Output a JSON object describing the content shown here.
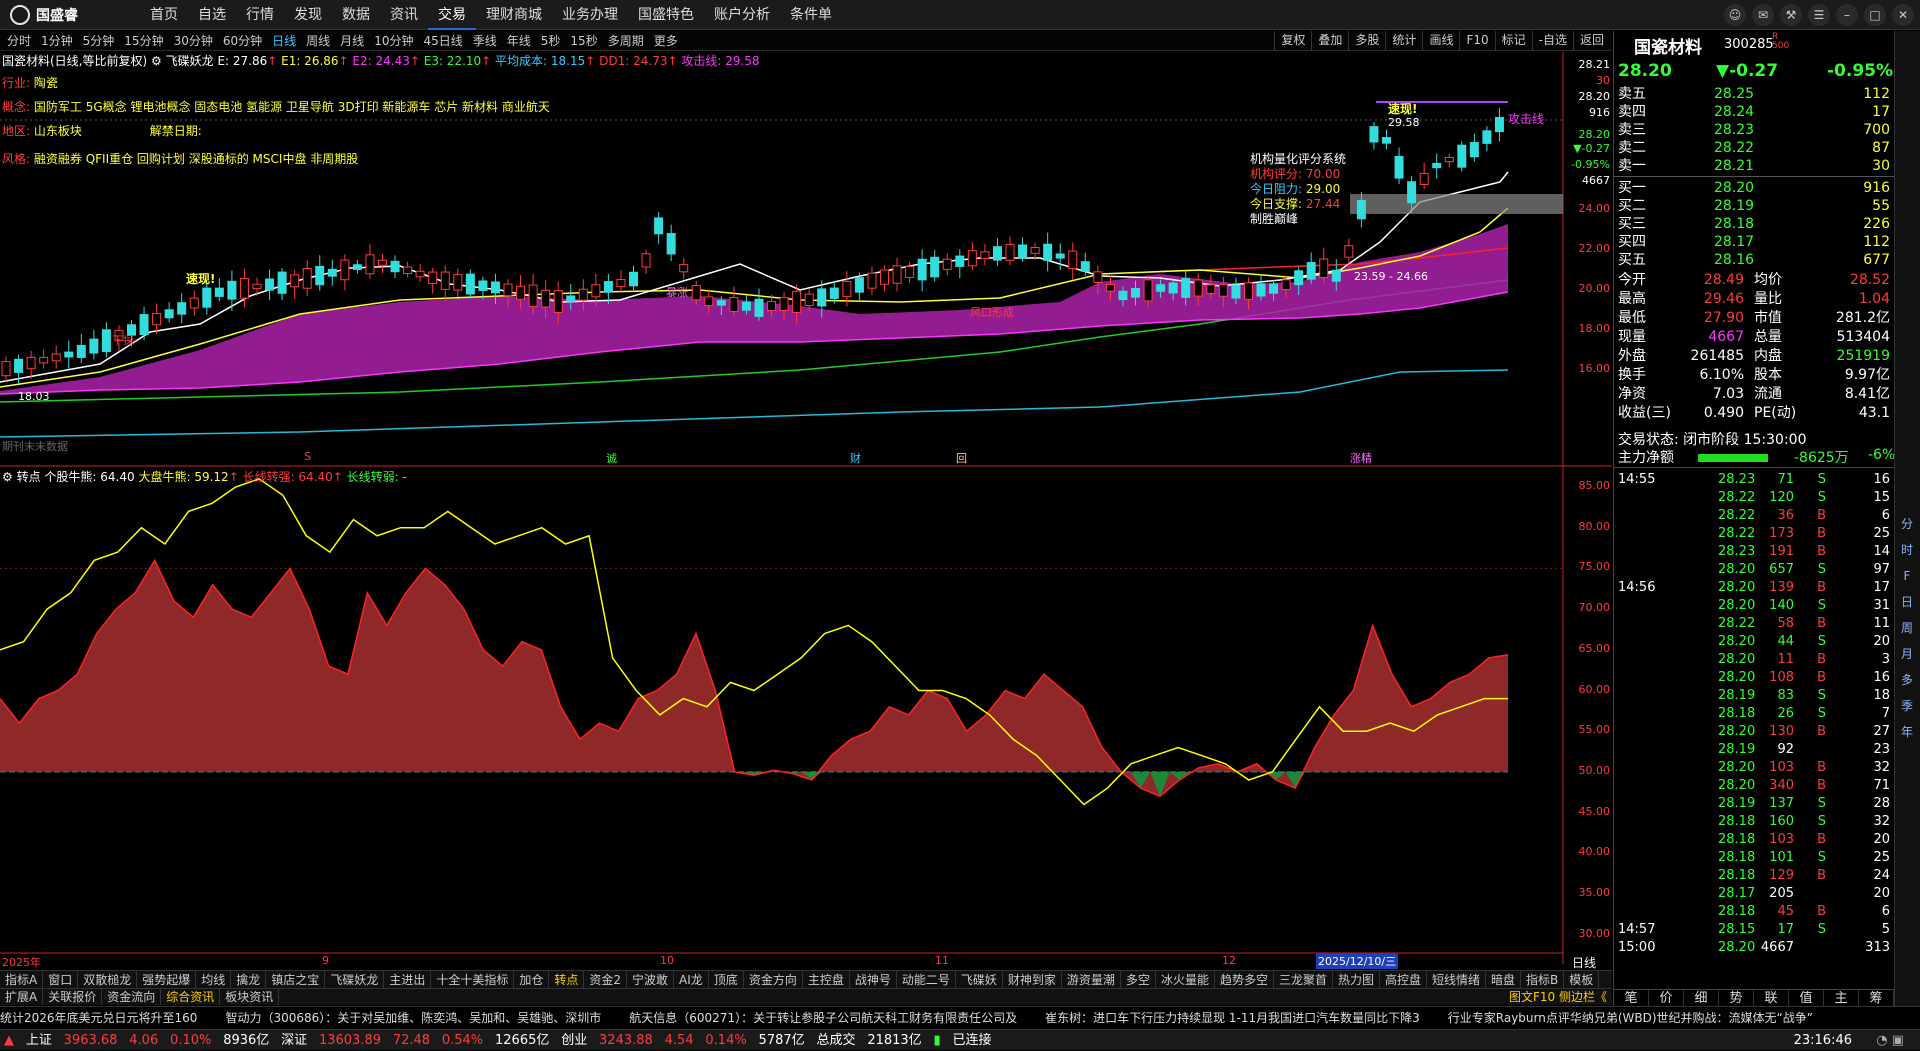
{
  "app": {
    "brand": "国盛睿",
    "menus": [
      "首页",
      "自选",
      "行情",
      "发现",
      "数据",
      "资讯",
      "交易",
      "理财商城",
      "业务办理",
      "国盛特色",
      "账户分析",
      "条件单"
    ],
    "active_menu": "交易",
    "window_controls": [
      "客服",
      "消息",
      "工具",
      "换肤",
      "最小化",
      "最大化",
      "关闭"
    ]
  },
  "periods": [
    "分时",
    "1分钟",
    "5分钟",
    "15分钟",
    "30分钟",
    "60分钟",
    "日线",
    "周线",
    "月线",
    "10分钟",
    "45日线",
    "季线",
    "年线",
    "5秒",
    "15秒",
    "多周期",
    "更多"
  ],
  "selected_period": "日线",
  "chart_buttons": [
    "复权",
    "叠加",
    "多股",
    "统计",
    "画线",
    "F10",
    "标记",
    "-自选",
    "返回"
  ],
  "header": {
    "title": "国瓷材料(日线,等比前复权)",
    "indicator": "飞碟妖龙",
    "E": "E: 27.86",
    "E1": "E1: 26.86",
    "E2": "E2: 24.43",
    "E3": "E3: 22.10",
    "avg_cost": "平均成本: 18.15",
    "dd1": "DD1: 24.73",
    "attack": "攻击线: 29.58"
  },
  "info": {
    "industry_label": "行业:",
    "industry": "陶瓷",
    "concept_label": "概念:",
    "concept": "国防军工 5G概念 锂电池概念 固态电池 氢能源 卫星导航 3D打印 新能源车 芯片 新材料 商业航天",
    "region_label": "地区:",
    "region": "山东板块",
    "unlock_label": "解禁日期:",
    "style_label": "风格:",
    "style": "融资融券 QFII重仓 回购计划 深股通标的 MSCI中盘 非周期股"
  },
  "quant_box": {
    "title": "机构量化评分系统",
    "score_label": "机构评分:",
    "score": "70.00",
    "resist_label": "今日阻力:",
    "resist": "29.00",
    "support_label": "今日支撑:",
    "support": "27.44",
    "status": "制胜巅峰"
  },
  "annotations": {
    "attack_line": "攻击线",
    "high_mark": "29.58",
    "low_mark": "18.03",
    "quick_1": "速现!",
    "quick_2": "速现!",
    "xiangao": "下探",
    "wind": "风口形成",
    "zhang": "暴涨",
    "range": "23.59 - 24.66",
    "no_data": "期刊末末数据",
    "events": [
      "S",
      "诚",
      "财",
      "回",
      "涨精"
    ]
  },
  "price_axis": [
    "28.21",
    "30",
    "28.20",
    "916",
    "28.20",
    "▼-0.27",
    "-0.95%",
    "4667",
    "24.00",
    "22.00",
    "20.00",
    "18.00",
    "16.00"
  ],
  "sub_header": {
    "name": "转点",
    "stock": "个股牛熊: 64.40",
    "market": "大盘牛熊: 59.12",
    "long_strong": "长线转强: 64.40",
    "long_weak": "长线转弱: -"
  },
  "sub_axis": [
    "85.00",
    "80.00",
    "75.00",
    "70.00",
    "65.00",
    "60.00",
    "55.00",
    "50.00",
    "45.00",
    "40.00",
    "35.00",
    "30.00"
  ],
  "date_axis": {
    "labels": [
      "2025年",
      "9",
      "10",
      "11",
      "12"
    ],
    "current": "2025/12/10/三",
    "mode": "日线"
  },
  "chart_data": {
    "type": "line",
    "series": [
      {
        "name": "个股牛熊",
        "color": "#cc2222",
        "values": [
          59,
          56,
          59,
          60,
          62,
          67,
          70,
          72,
          76,
          71,
          69,
          73,
          70,
          69,
          72,
          75,
          70,
          63,
          62,
          72,
          68,
          72,
          75,
          73,
          70,
          65,
          63,
          66,
          65,
          58,
          54,
          56,
          55,
          59,
          60,
          62,
          67,
          60,
          50,
          49.6,
          50.2,
          49.8,
          49,
          52,
          54,
          55,
          58,
          57,
          60,
          59,
          55,
          57,
          60,
          59,
          62,
          60,
          58,
          53,
          50,
          48,
          47,
          49,
          50.5,
          51,
          50,
          51,
          49,
          48,
          53,
          57,
          60,
          68,
          62,
          58,
          59,
          61,
          62,
          64,
          64.4
        ]
      },
      {
        "name": "大盘牛熊",
        "color": "#ffff00",
        "values": [
          65,
          66,
          70,
          72,
          76,
          77,
          80,
          78,
          82,
          83,
          85,
          86,
          84,
          79,
          77,
          81,
          79,
          80,
          80,
          82,
          80,
          78,
          79,
          80,
          78,
          79,
          64,
          60,
          57,
          59,
          58,
          61,
          60,
          62,
          64,
          67,
          68,
          66,
          63,
          60,
          60,
          59,
          57,
          54,
          52,
          49,
          46,
          48,
          51,
          52,
          53,
          52,
          51,
          49,
          50,
          54,
          58,
          55,
          55,
          56,
          55,
          57,
          58,
          59,
          59
        ]
      }
    ],
    "ylim": [
      25,
      87
    ],
    "xlabel": "",
    "ylabel": ""
  },
  "quote": {
    "name": "国瓷材料",
    "code": "300285",
    "price": "28.20",
    "change": "▼-0.27",
    "pct": "-0.95%",
    "asks": [
      {
        "label": "卖五",
        "price": "28.25",
        "vol": "112"
      },
      {
        "label": "卖四",
        "price": "28.24",
        "vol": "17"
      },
      {
        "label": "卖三",
        "price": "28.23",
        "vol": "700"
      },
      {
        "label": "卖二",
        "price": "28.22",
        "vol": "87"
      },
      {
        "label": "卖一",
        "price": "28.21",
        "vol": "30"
      }
    ],
    "bids": [
      {
        "label": "买一",
        "price": "28.20",
        "vol": "916"
      },
      {
        "label": "买二",
        "price": "28.19",
        "vol": "55"
      },
      {
        "label": "买三",
        "price": "28.18",
        "vol": "226"
      },
      {
        "label": "买四",
        "price": "28.17",
        "vol": "112"
      },
      {
        "label": "买五",
        "price": "28.16",
        "vol": "677"
      }
    ],
    "stats": [
      {
        "l1": "今开",
        "v1": "28.49",
        "l2": "均价",
        "v2": "28.52"
      },
      {
        "l1": "最高",
        "v1": "29.46",
        "l2": "量比",
        "v2": "1.04"
      },
      {
        "l1": "最低",
        "v1": "27.90",
        "l2": "市值",
        "v2": "281.2亿"
      },
      {
        "l1": "现量",
        "v1": "4667",
        "l2": "总量",
        "v2": "513404"
      },
      {
        "l1": "外盘",
        "v1": "261485",
        "l2": "内盘",
        "v2": "251919"
      },
      {
        "l1": "换手",
        "v1": "6.10%",
        "l2": "股本",
        "v2": "9.97亿"
      },
      {
        "l1": "净资",
        "v1": "7.03",
        "l2": "流通",
        "v2": "8.41亿"
      },
      {
        "l1": "收益(三)",
        "v1": "0.490",
        "l2": "PE(动)",
        "v2": "43.1"
      }
    ],
    "trade_state": "交易状态: 闭市阶段 15:30:00",
    "net_flow_label": "主力净额",
    "net_flow": "-8625万",
    "net_flow_pct": "-6%"
  },
  "ticks": [
    {
      "t": "14:55",
      "p": "28.23",
      "v": "71",
      "d": "S",
      "n": "16"
    },
    {
      "t": "",
      "p": "28.22",
      "v": "120",
      "d": "S",
      "n": "15"
    },
    {
      "t": "",
      "p": "28.22",
      "v": "36",
      "d": "B",
      "n": "6"
    },
    {
      "t": "",
      "p": "28.22",
      "v": "173",
      "d": "B",
      "n": "25"
    },
    {
      "t": "",
      "p": "28.23",
      "v": "191",
      "d": "B",
      "n": "14"
    },
    {
      "t": "",
      "p": "28.20",
      "v": "657",
      "d": "S",
      "n": "97"
    },
    {
      "t": "14:56",
      "p": "28.20",
      "v": "139",
      "d": "B",
      "n": "17"
    },
    {
      "t": "",
      "p": "28.20",
      "v": "140",
      "d": "S",
      "n": "31"
    },
    {
      "t": "",
      "p": "28.22",
      "v": "58",
      "d": "B",
      "n": "11"
    },
    {
      "t": "",
      "p": "28.20",
      "v": "44",
      "d": "S",
      "n": "20"
    },
    {
      "t": "",
      "p": "28.20",
      "v": "11",
      "d": "B",
      "n": "3"
    },
    {
      "t": "",
      "p": "28.20",
      "v": "108",
      "d": "B",
      "n": "16"
    },
    {
      "t": "",
      "p": "28.19",
      "v": "83",
      "d": "S",
      "n": "18"
    },
    {
      "t": "",
      "p": "28.18",
      "v": "26",
      "d": "S",
      "n": "7"
    },
    {
      "t": "",
      "p": "28.20",
      "v": "130",
      "d": "B",
      "n": "27"
    },
    {
      "t": "",
      "p": "28.19",
      "v": "92",
      "d": "",
      "n": "23"
    },
    {
      "t": "",
      "p": "28.20",
      "v": "103",
      "d": "B",
      "n": "32"
    },
    {
      "t": "",
      "p": "28.20",
      "v": "340",
      "d": "B",
      "n": "71"
    },
    {
      "t": "",
      "p": "28.19",
      "v": "137",
      "d": "S",
      "n": "28"
    },
    {
      "t": "",
      "p": "28.18",
      "v": "160",
      "d": "S",
      "n": "32"
    },
    {
      "t": "",
      "p": "28.18",
      "v": "103",
      "d": "B",
      "n": "20"
    },
    {
      "t": "",
      "p": "28.18",
      "v": "101",
      "d": "S",
      "n": "25"
    },
    {
      "t": "",
      "p": "28.18",
      "v": "129",
      "d": "B",
      "n": "24"
    },
    {
      "t": "",
      "p": "28.17",
      "v": "205",
      "d": "",
      "n": "20"
    },
    {
      "t": "",
      "p": "28.18",
      "v": "45",
      "d": "B",
      "n": "6"
    },
    {
      "t": "14:57",
      "p": "28.15",
      "v": "17",
      "d": "S",
      "n": "5"
    },
    {
      "t": "15:00",
      "p": "28.20",
      "v": "4667",
      "d": "",
      "n": "313"
    }
  ],
  "right_bottom_tabs": [
    "笔",
    "价",
    "细",
    "势",
    "联",
    "值",
    "主",
    "筹"
  ],
  "sidebar": [
    "分",
    "时",
    "F",
    "日",
    "周",
    "月",
    "多",
    "季",
    "年"
  ],
  "bottom_tabs": [
    "指标A",
    "窗口",
    "双散槌龙",
    "强势起爆",
    "均线",
    "擒龙",
    "镇店之宝",
    "飞碟妖龙",
    "主进出",
    "十全十美指标",
    "加仓",
    "转点",
    "资金2",
    "宁波敢",
    "AI龙",
    "顶底",
    "资金方向",
    "主控盘",
    "战神号",
    "动能二号",
    "飞碟妖",
    "财神到家",
    "游资量潮",
    "多空",
    "冰火量能",
    "趋势多空",
    "三龙聚首",
    "热力图",
    "高控盘",
    "短线情绪",
    "暗盘",
    "指标B",
    "模板"
  ],
  "selected_bottom_tab": "转点",
  "tabs2": [
    "扩展A",
    "关联报价",
    "资金流向",
    "综合资讯",
    "板块资讯"
  ],
  "selected_tab2": "综合资讯",
  "tabs2_right": "图文F10 侧边栏《",
  "news": [
    "统计2026年底美元兑日元将升至160",
    "智动力（300686）：关于对吴加维、陈奕鸿、吴加和、吴雄驰、深圳市",
    "航天信息（600271）：关于转让参股子公司航天科工财务有限责任公司及",
    "崔东树：进口车下行压力持续显现 1-11月我国进口汽车数量同比下降3",
    "行业专家Rayburn点评华纳兄弟(WBD)世纪并购战：流媒体无“战争”"
  ],
  "status": {
    "sh_label": "上证",
    "sh": "3963.68",
    "sh_chg": "4.06",
    "sh_pct": "0.10%",
    "sh_amt": "8936亿",
    "sz_label": "深证",
    "sz": "13603.89",
    "sz_chg": "72.48",
    "sz_pct": "0.54%",
    "sz_amt": "12665亿",
    "cy_label": "创业",
    "cy": "3243.88",
    "cy_chg": "4.54",
    "cy_pct": "0.14%",
    "cy_amt": "5787亿",
    "total_label": "总成交",
    "total": "21813亿",
    "conn": "已连接",
    "time": "23:16:46"
  }
}
